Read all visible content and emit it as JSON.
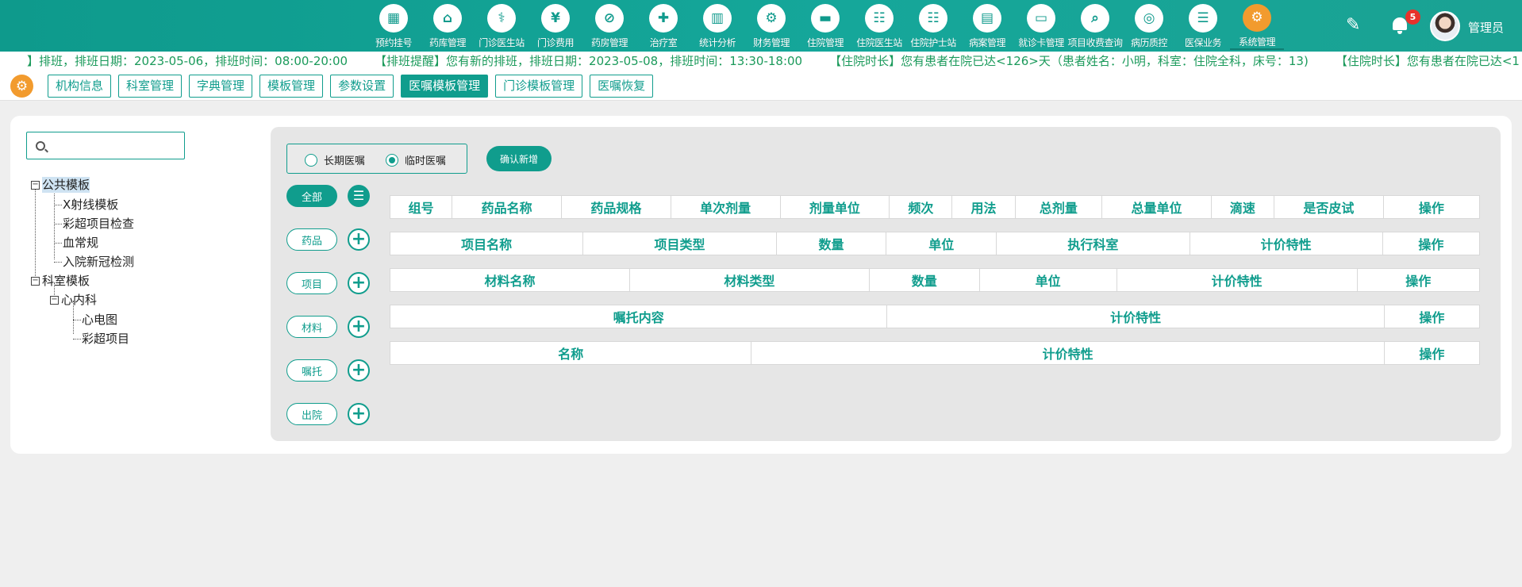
{
  "nav": [
    {
      "label": "预约挂号",
      "icon": "calendar-icon",
      "glyph": "▦"
    },
    {
      "label": "药库管理",
      "icon": "pharmacy-house-icon",
      "glyph": "⌂"
    },
    {
      "label": "门诊医生站",
      "icon": "doctor-icon",
      "glyph": "⚕"
    },
    {
      "label": "门诊费用",
      "icon": "yen-icon",
      "glyph": "¥"
    },
    {
      "label": "药房管理",
      "icon": "pill-icon",
      "glyph": "⊘"
    },
    {
      "label": "治疗室",
      "icon": "nurse-icon",
      "glyph": "✚"
    },
    {
      "label": "统计分析",
      "icon": "bar-chart-icon",
      "glyph": "▥"
    },
    {
      "label": "财务管理",
      "icon": "finance-gear-icon",
      "glyph": "⚙"
    },
    {
      "label": "住院管理",
      "icon": "bed-icon",
      "glyph": "▬"
    },
    {
      "label": "住院医生站",
      "icon": "doctor-card-icon",
      "glyph": "☷"
    },
    {
      "label": "住院护士站",
      "icon": "nurse-card-icon",
      "glyph": "☷"
    },
    {
      "label": "病案管理",
      "icon": "record-icon",
      "glyph": "▤"
    },
    {
      "label": "就诊卡管理",
      "icon": "card-icon",
      "glyph": "▭"
    },
    {
      "label": "项目收费查询",
      "icon": "search-document-icon",
      "glyph": "⌕"
    },
    {
      "label": "病历质控",
      "icon": "quality-control-icon",
      "glyph": "◎"
    },
    {
      "label": "医保业务",
      "icon": "insurance-card-icon",
      "glyph": "☰"
    },
    {
      "label": "系统管理",
      "icon": "system-gear-icon",
      "glyph": "⚙",
      "active": true
    }
  ],
  "user": {
    "name": "管理员",
    "notification_count": "5"
  },
  "marquee": [
    "】排班，排班日期：2023-05-06，排班时间：08:00-20:00",
    "【排班提醒】您有新的排班，排班日期：2023-05-08，排班时间：13:30-18:00",
    "【住院时长】您有患者在院已达<126>天（患者姓名：小明，科室：住院全科，床号：13)",
    "【住院时长】您有患者在院已达<1"
  ],
  "subtabs": [
    "机构信息",
    "科室管理",
    "字典管理",
    "模板管理",
    "参数设置",
    "医嘱模板管理",
    "门诊模板管理",
    "医嘱恢复"
  ],
  "active_subtab": "医嘱模板管理",
  "search": {
    "placeholder": ""
  },
  "tree": {
    "public": "公共模板",
    "public_items": [
      "X射线模板",
      "彩超项目检查",
      "血常规",
      "入院新冠检测"
    ],
    "dept": "科室模板",
    "dept_child": "心内科",
    "dept_items": [
      "心电图",
      "彩超项目"
    ]
  },
  "order_type": {
    "long_term": "长期医嘱",
    "temporary": "临时医嘱",
    "selected": "临时医嘱"
  },
  "confirm_label": "确认新增",
  "categories": [
    "全部",
    "药品",
    "项目",
    "材料",
    "嘱托",
    "出院"
  ],
  "tables": {
    "drug": [
      "组号",
      "药品名称",
      "药品规格",
      "单次剂量",
      "剂量单位",
      "频次",
      "用法",
      "总剂量",
      "总量单位",
      "滴速",
      "是否皮试",
      "操作"
    ],
    "item": [
      "项目名称",
      "项目类型",
      "数量",
      "单位",
      "执行科室",
      "计价特性",
      "操作"
    ],
    "material": [
      "材料名称",
      "材料类型",
      "数量",
      "单位",
      "计价特性",
      "操作"
    ],
    "entrust": [
      "嘱托内容",
      "计价特性",
      "操作"
    ],
    "discharge": [
      "名称",
      "计价特性",
      "操作"
    ]
  },
  "colors": {
    "primary": "#109d8d",
    "accent": "#f29b2e",
    "badge": "#e8322b"
  }
}
